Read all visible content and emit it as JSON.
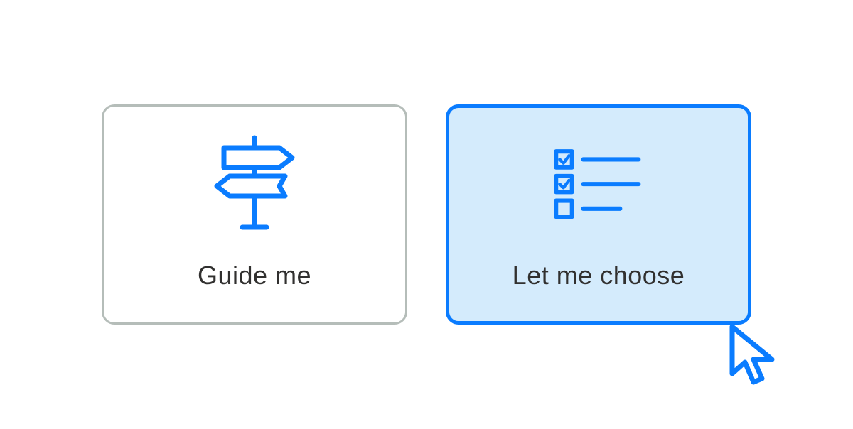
{
  "options": {
    "guide": {
      "label": "Guide me",
      "icon": "signpost-icon",
      "selected": false
    },
    "choose": {
      "label": "Let me choose",
      "icon": "checklist-icon",
      "selected": true
    }
  },
  "colors": {
    "accent": "#0a7cff",
    "border_inactive": "#b5bdb9",
    "selected_bg": "#d4ebfc",
    "text": "#31302f"
  }
}
